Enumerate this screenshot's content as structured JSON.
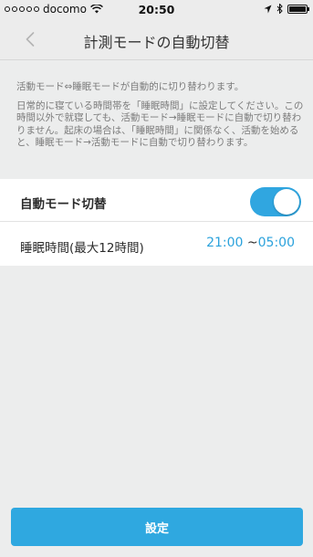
{
  "status_bar": {
    "carrier": "docomo",
    "time": "20:50"
  },
  "nav": {
    "title": "計測モードの自動切替",
    "back_icon": "chevron-left-icon"
  },
  "description": {
    "line1": "活動モード⇔睡眠モードが自動的に切り替わります。",
    "paragraph2": "日常的に寝ている時間帯を「睡眠時間」に設定してください。この時間以外で就寝しても、活動モード→睡眠モードに自動で切り替わりません。起床の場合は、「睡眠時間」に関係なく、活動を始めると、睡眠モード→活動モードに自動で切り替わります。"
  },
  "settings": {
    "auto_switch_label": "自動モード切替",
    "auto_switch_on": true,
    "sleep_time_label": "睡眠時間(最大12時間)",
    "sleep_start": "21:00",
    "sleep_separator": "~",
    "sleep_end": "05:00"
  },
  "footer": {
    "set_button_label": "設定"
  },
  "colors": {
    "accent": "#30a6e0",
    "time_text": "#2ba2dc",
    "background": "#eceded"
  }
}
